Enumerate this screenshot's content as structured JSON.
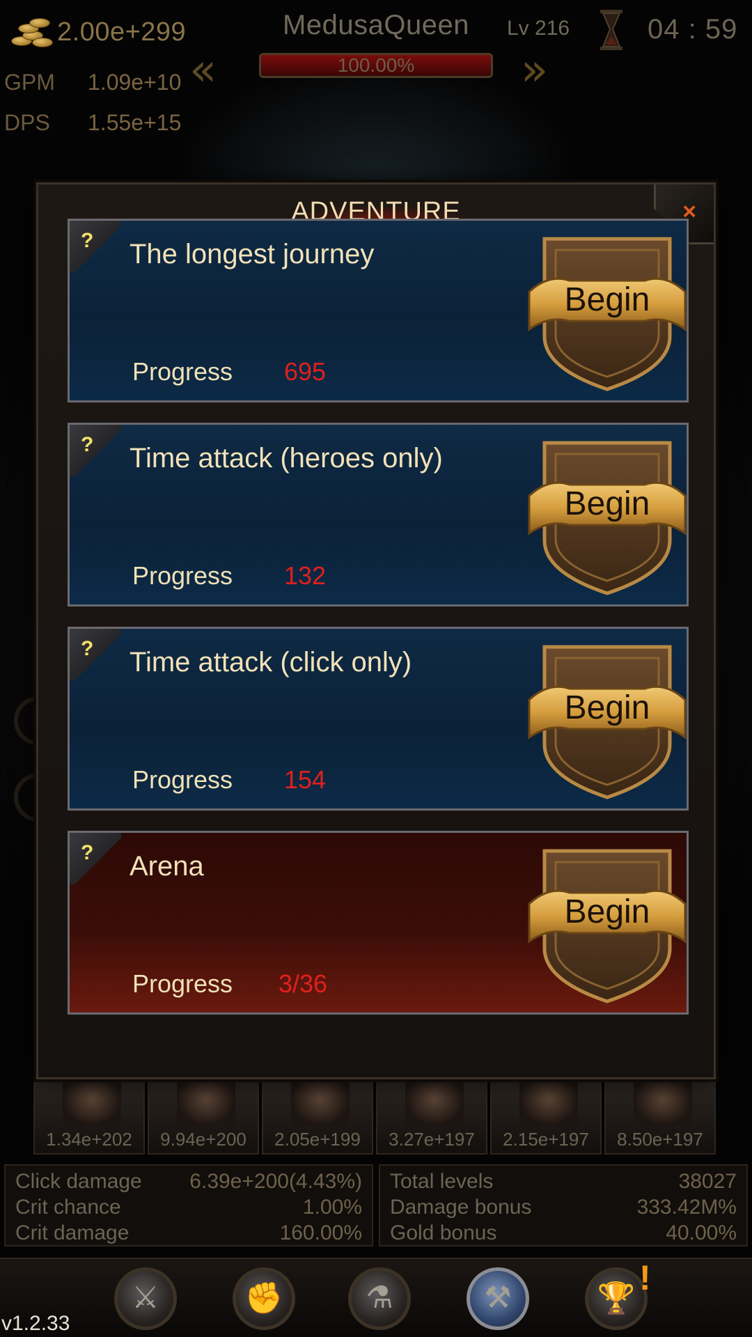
{
  "hud": {
    "gold": "2.00e+299",
    "gpm_label": "GPM",
    "gpm_value": "1.09e+10",
    "dps_label": "DPS",
    "dps_value": "1.55e+15",
    "player_name": "MedusaQueen",
    "level": "Lv 216",
    "timer": "04 : 59",
    "health_percent_text": "100.00%",
    "health_fraction": 1.0,
    "icons": [
      "gold-coins-icon",
      "hourglass-icon",
      "arrow-left-icon",
      "arrow-right-icon"
    ]
  },
  "modal": {
    "title": "ADVENTURE",
    "close_glyph": "×",
    "help_glyph": "?",
    "begin_label": "Begin",
    "progress_label": "Progress",
    "modes": [
      {
        "name": "The longest journey",
        "progress": "695",
        "theme": "blue"
      },
      {
        "name": "Time attack (heroes only)",
        "progress": "132",
        "theme": "blue"
      },
      {
        "name": "Time attack (click only)",
        "progress": "154",
        "theme": "blue"
      },
      {
        "name": "Arena",
        "progress": "3/36",
        "theme": "red"
      }
    ],
    "colors": {
      "blue_card": "#0c2540",
      "red_card": "#3b0d08",
      "progress_value": "#e0201c",
      "help_mark": "#f3e06a",
      "close_x": "#e25b1e"
    }
  },
  "heroes": [
    {
      "dmg": "1.34e+202"
    },
    {
      "dmg": "9.94e+200"
    },
    {
      "dmg": "2.05e+199"
    },
    {
      "dmg": "3.27e+197"
    },
    {
      "dmg": "2.15e+197"
    },
    {
      "dmg": "8.50e+197"
    }
  ],
  "stats": {
    "left": [
      {
        "label": "Click damage",
        "value": "6.39e+200(4.43%)"
      },
      {
        "label": "Crit chance",
        "value": "1.00%"
      },
      {
        "label": "Crit damage",
        "value": "160.00%"
      }
    ],
    "right": [
      {
        "label": "Total levels",
        "value": "38027"
      },
      {
        "label": "Damage bonus",
        "value": "333.42M%"
      },
      {
        "label": "Gold bonus",
        "value": "40.00%"
      }
    ]
  },
  "nav": {
    "items": [
      {
        "icon": "crossed-swords-icon",
        "glyph": "⚔"
      },
      {
        "icon": "fist-icon",
        "glyph": "✊"
      },
      {
        "icon": "potion-icon",
        "glyph": "⚗"
      },
      {
        "icon": "axe-helmet-icon",
        "glyph": "⚒",
        "active": true
      },
      {
        "icon": "trophy-icon",
        "glyph": "🏆",
        "alert": "!"
      }
    ]
  },
  "version": "v1.2.33"
}
